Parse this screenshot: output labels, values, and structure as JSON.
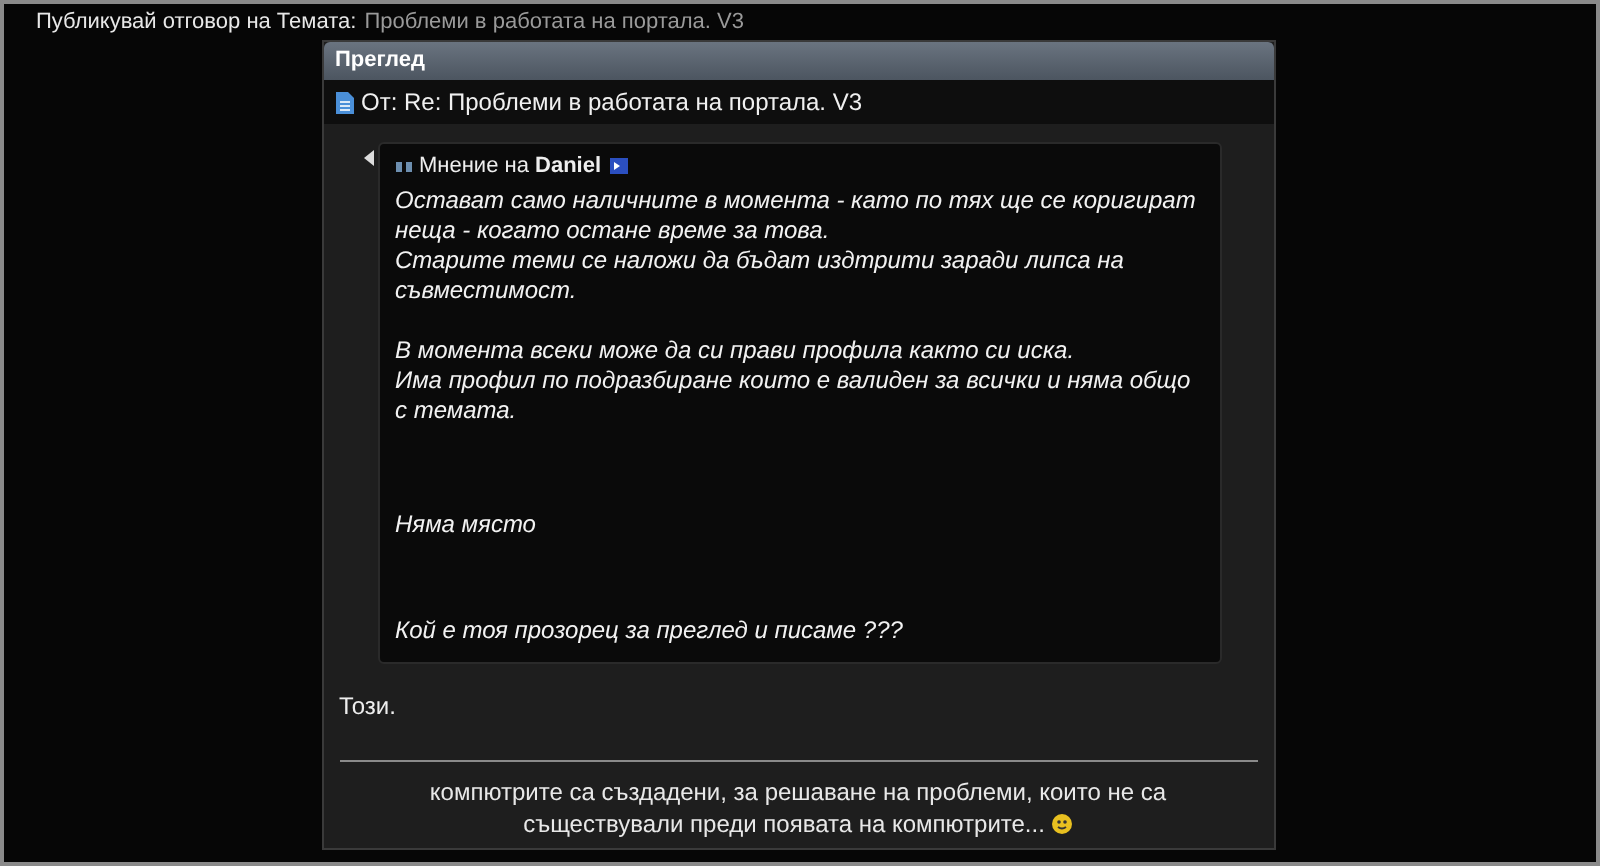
{
  "heading": {
    "label": "Публикувай отговор на Темата:",
    "topic": "Проблеми в работата на портала. V3"
  },
  "preview": {
    "title": "Преглед",
    "post_title": "От: Re: Проблеми в работата на портала. V3",
    "quote": {
      "intro": "Мнение на",
      "author": "Daniel",
      "paragraphs": [
        "Остават само наличните в момента - като по тях ще се коригират неща - когато остане време за това.\nСтарите теми се наложи да бъдат издтрити заради липса на съвместимост.",
        "В момента всеки може да си прави профила както си иска.\nИма профил по подразбиране които е валиден за всички и няма общо с темата.",
        "Няма място",
        "Кой е тоя прозорец за преглед и писаме ???"
      ]
    },
    "reply": "Този.",
    "signature": "компютрите са създадени, за решаване на проблеми, които не са съществували преди появата на компютрите..."
  }
}
